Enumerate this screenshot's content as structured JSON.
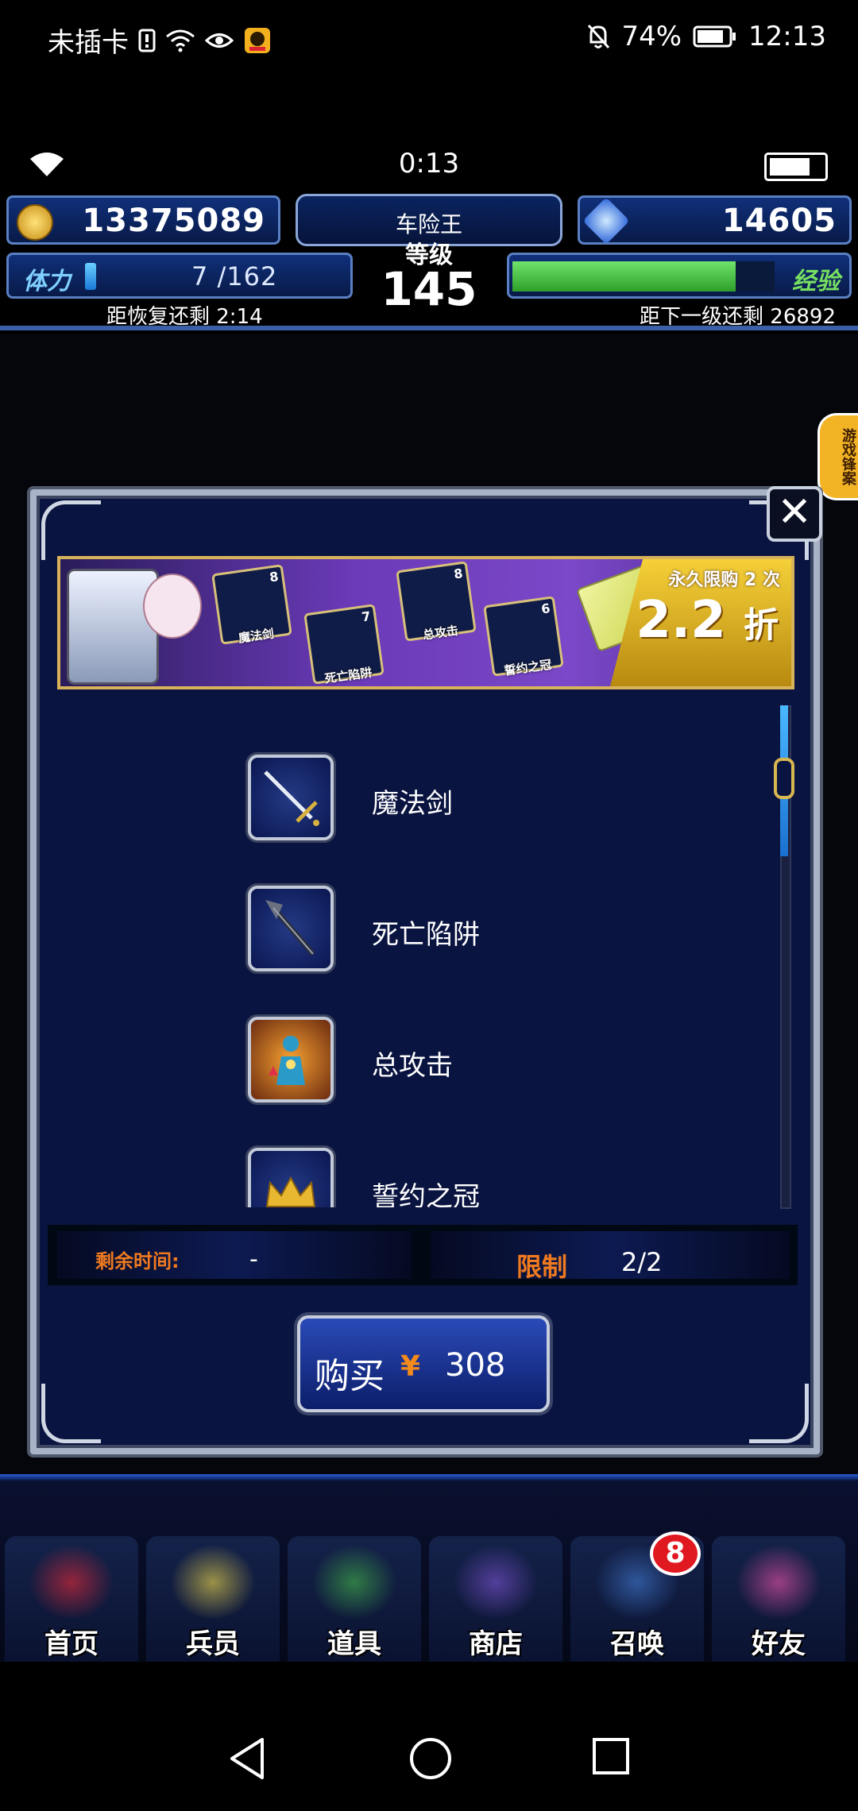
{
  "status_bar": {
    "carrier": "未插卡",
    "battery_percent": "74%",
    "time": "12:13"
  },
  "game_hud": {
    "clock": "0:13",
    "gil": "13375089",
    "gems": "14605",
    "player_name": "车险王",
    "level_label": "等级",
    "level": "145",
    "stamina_label": "体力",
    "stamina_value": "7 /162",
    "stamina_fraction": 0.043,
    "stamina_recover": "距恢复还剩 2:14",
    "exp_label": "经验",
    "exp_fraction": 0.85,
    "exp_next": "距下一级还剩 26892",
    "side_tab": "游戏锋案"
  },
  "modal": {
    "banner": {
      "items": [
        {
          "label": "魔法剑",
          "count": "8"
        },
        {
          "label": "死亡陷阱",
          "count": "7"
        },
        {
          "label": "总攻击",
          "count": "8"
        },
        {
          "label": "誓约之冠",
          "count": "6"
        }
      ],
      "limit_text": "永久限购 2 次",
      "discount": "2.2",
      "discount_unit": "折"
    },
    "items": [
      {
        "name": "魔法剑",
        "icon": "sword-icon"
      },
      {
        "name": "死亡陷阱",
        "icon": "staff-icon"
      },
      {
        "name": "总攻击",
        "icon": "ability-figure-icon"
      },
      {
        "name": "誓约之冠",
        "icon": "crown-icon"
      }
    ],
    "remaining_label": "剩余时间:",
    "remaining_value": "-",
    "limit_label": "限制",
    "limit_value": "2/2",
    "buy_label": "购买",
    "currency_symbol": "¥",
    "price": "308"
  },
  "bottom_nav": {
    "items": [
      {
        "label": "首页",
        "color": "#c0283a"
      },
      {
        "label": "兵员",
        "color": "#c8b84a"
      },
      {
        "label": "道具",
        "color": "#3a9a48"
      },
      {
        "label": "商店",
        "color": "#6a4ab8"
      },
      {
        "label": "召唤",
        "color": "#3a6ab8"
      },
      {
        "label": "好友",
        "color": "#c84a9a"
      }
    ],
    "summon_badge": "8"
  },
  "colors": {
    "accent_orange": "#f07a20",
    "frame_silver": "#a9b3c8",
    "modal_bg": "#0a1440"
  }
}
